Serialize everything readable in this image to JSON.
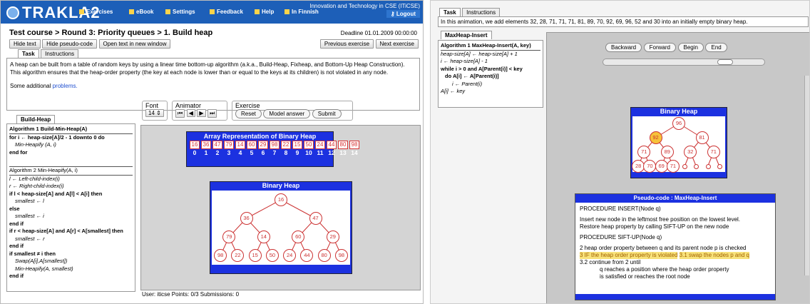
{
  "left": {
    "logo": "TRAKLA2",
    "nav": [
      "Exercises",
      "eBook",
      "Settings",
      "Feedback",
      "Help",
      "In Finnish"
    ],
    "course": "Innovation and Technology in CSE (ITiCSE)",
    "logout": "Logout",
    "breadcrumb": "Test course > Round 3: Priority queues > 1. Build heap",
    "deadline": "Deadline 01.01.2009 00:00:00",
    "buttons": [
      "Hide text",
      "Hide pseudo-code",
      "Open text in new window"
    ],
    "nav_buttons": [
      "Previous exercise",
      "Next exercise"
    ],
    "tabs": [
      "Task",
      "Instructions"
    ],
    "task_text_1": "A heap can be built from a table of random keys by using a linear time bottom-up algorithm (a.k.a., Build-Heap, Fixheap, and Bottom-Up Heap Construction). This algorithm ensures that the heap-order property (the key at each node is lower than or equal to the keys at its children) is not violated in any node.",
    "task_text_2": "Some additional",
    "task_link": "problems.",
    "algo_tab": "Build-Heap",
    "algo_lines": [
      "Algorithm 1 Build-Min-Heap(A)",
      "for i ← heap-size[A]/2 - 1 downto 0 do",
      "Min-Heapify (A, i)",
      "end for",
      "",
      "Algorithm 2 Min-Heapify(A, i)",
      "l ← Left-child-index(i)",
      "r ← Right-child-index(i)",
      "if l < heap-size[A] and A[l] < A[i] then",
      "smallest ← l",
      "else",
      "smallest ← i",
      "end if",
      "if r < heap-size[A] and A[r] < A[smallest] then",
      "smallest ← r",
      "end if",
      "if smallest ≠ i then",
      "Swap(A[i],A[smallest])",
      "Min-Heapify(A, smallest)",
      "end if"
    ],
    "font_label": "Font",
    "font_value": "14",
    "animator_label": "Animator",
    "anim_icons": [
      "first-icon",
      "back-icon",
      "forward-icon",
      "last-icon"
    ],
    "exercise_label": "Exercise",
    "exercise_buttons": [
      "Reset",
      "Model answer",
      "Submit"
    ],
    "array_title": "Array Representation of Binary Heap",
    "array_values": [
      "16",
      "36",
      "47",
      "79",
      "14",
      "60",
      "29",
      "98",
      "22",
      "15",
      "50",
      "24",
      "44",
      "80",
      "98"
    ],
    "array_index": [
      "0",
      "1",
      "2",
      "3",
      "4",
      "5",
      "6",
      "7",
      "8",
      "9",
      "10",
      "11",
      "12",
      "13",
      "14"
    ],
    "heap_title": "Binary Heap",
    "heap_nodes": [
      "16",
      "36",
      "47",
      "79",
      "14",
      "60",
      "29",
      "98",
      "22",
      "15",
      "50",
      "24",
      "44",
      "80",
      "98"
    ],
    "status": "User: iticse   Points: 0/3   Submissions: 0"
  },
  "right": {
    "tabs": [
      "Task",
      "Instructions"
    ],
    "task_text": "In this animation, we add elements 32, 28, 71, 71, 71, 81, 89, 70, 92, 69, 96, 52 and 30 into an initially empty binary heap.",
    "algo_tab": "MaxHeap-Insert",
    "algo_lines": [
      "Algorithm 1 MaxHeap-Insert(A, key)",
      "heap-size[A] ← heap-size[A] + 1",
      "i ← heap-size[A] - 1",
      "while i > 0 and A[Parent(i)] < key",
      "do A[i] ← A[Parent(i)]",
      "i ← Parent(i)",
      "A[i] ← key"
    ],
    "controls": [
      "Backward",
      "Forward",
      "Begin",
      "End"
    ],
    "heap_title": "Binary Heap",
    "heap_nodes": [
      "96",
      "92",
      "81",
      "71",
      "89",
      "32",
      "71",
      "28",
      "70",
      "69",
      "71"
    ],
    "ps_title": "Pseudo-code : MaxHeap-Insert",
    "ps_lines": [
      "PROCEDURE INSERT(Node q)",
      "Insert new node in the leftmost free position on the lowest level.",
      "Restore heap property by calling SIFT-UP on the new node",
      "PROCEDURE SIFT-UP(Node q)",
      "2   heap order property between q and its parent node p is checked",
      "3   IF the heap order property is violated",
      "3.1    swap the nodes p and q",
      "3.2    continue from 2 until",
      "q reaches a position where the heap order property",
      "is satisfied or reaches the root node"
    ]
  },
  "colors": {
    "topbar": "#1d5fb8",
    "panel_blue": "#1c31e0",
    "node_red": "#cc3333",
    "highlight": "#f6c23b"
  }
}
